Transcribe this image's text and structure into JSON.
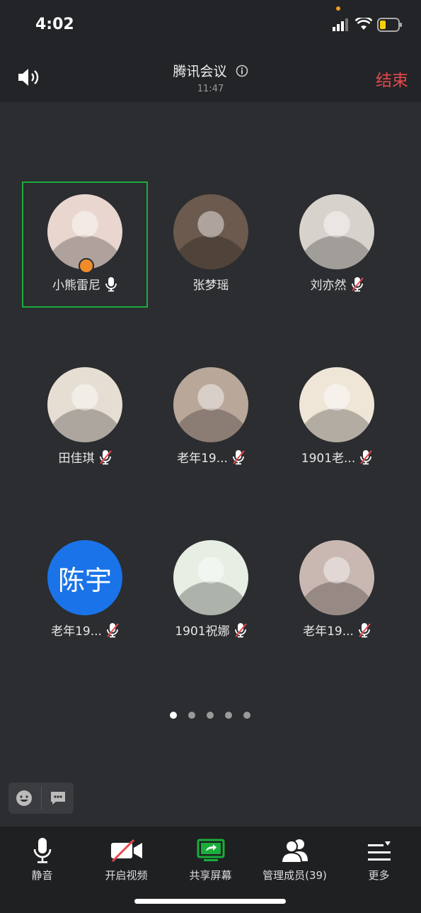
{
  "status": {
    "time": "4:02"
  },
  "header": {
    "title": "腾讯会议",
    "subtitle": "11:47",
    "end_label": "结束"
  },
  "participants": [
    {
      "name": "小熊雷尼",
      "mic": "on",
      "host": true,
      "active": true,
      "avatar_color": "#e9d7cf"
    },
    {
      "name": "张梦瑶",
      "mic": "none",
      "avatar_color": "#6b5a4d"
    },
    {
      "name": "刘亦然",
      "mic": "muted",
      "avatar_color": "#d7d2cc"
    },
    {
      "name": "田佳琪",
      "mic": "muted",
      "avatar_color": "#e6ded3"
    },
    {
      "name": "老年19...",
      "mic": "muted",
      "avatar_color": "#b9a79a"
    },
    {
      "name": "1901老...",
      "mic": "muted",
      "avatar_color": "#efe6d8"
    },
    {
      "name": "老年19...",
      "mic": "muted",
      "avatar_text": "陈宇",
      "avatar_color": "#1a73e8"
    },
    {
      "name": "1901祝娜",
      "mic": "muted",
      "avatar_color": "#e7efe4"
    },
    {
      "name": "老年19...",
      "mic": "muted",
      "avatar_color": "#c9b8b2"
    }
  ],
  "pager": {
    "pages": 5,
    "current": 0
  },
  "toolbar": {
    "mute_label": "静音",
    "video_label": "开启视频",
    "share_label": "共享屏幕",
    "members_label": "管理成员(39)",
    "more_label": "更多"
  },
  "colors": {
    "accent_green": "#1aad3b",
    "end_red": "#e5484d"
  }
}
